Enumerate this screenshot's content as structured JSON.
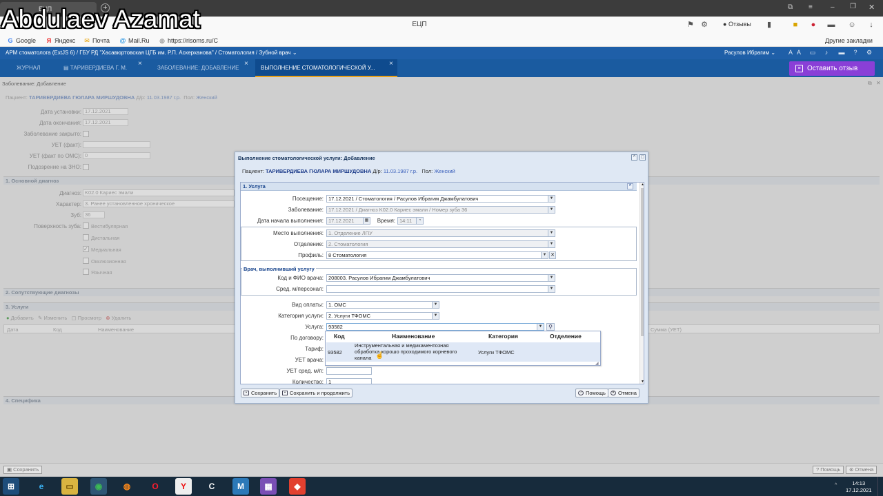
{
  "overlay": {
    "watermark": "Abdulaev Azamat"
  },
  "browser": {
    "tab_title": "ЕЦП",
    "site_title": "ЕЦП",
    "feedback_chip": "Отзывы",
    "bookmarks": [
      {
        "icon": "google-icon",
        "label": "Google"
      },
      {
        "icon": "yandex-icon",
        "label": "Яндекс"
      },
      {
        "icon": "mail-icon",
        "label": "Почта"
      },
      {
        "icon": "mailru-icon",
        "label": "Mail.Ru"
      },
      {
        "icon": "globe-icon",
        "label": "https://risoms.ru/C"
      }
    ],
    "other_bookmarks": "Другие закладки"
  },
  "app": {
    "title": "АРМ стоматолога (ExtJS 6) / ГБУ РД \"Хасавюртовская ЦГБ им. Р.П. Аскерханова\" / Стоматология / Зубной врач",
    "user": "Расулов Ибрагим",
    "tabs": [
      {
        "label": "ЖУРНАЛ"
      },
      {
        "label": "ТАРИВЕРДИЕВА Г. М."
      },
      {
        "label": "ЗАБОЛЕВАНИЕ: ДОБАВЛЕНИЕ"
      },
      {
        "label": "ВЫПОЛНЕНИЕ СТОМАТОЛОГИЧЕСКОЙ У..."
      }
    ],
    "feedback_button": "Оставить отзыв"
  },
  "background": {
    "title": "Заболевание: Добавление",
    "patient_label": "Пациент:",
    "patient_name": "ТАРИВЕРДИЕВА ГЮЛАРА МИРШУДОВНА",
    "dob_label": "Д/р:",
    "dob": "11.03.1987 г.р.",
    "sex_label": "Пол:",
    "sex": "Женский",
    "fields": [
      {
        "label": "Дата установки:",
        "value": "17.12.2021"
      },
      {
        "label": "Дата окончания:",
        "value": "17.12.2021"
      },
      {
        "label": "Заболевание закрыто:",
        "value": ""
      },
      {
        "label": "УЕТ (факт):",
        "value": ""
      },
      {
        "label": "УЕТ (факт по ОМС):",
        "value": "0"
      },
      {
        "label": "Подозрение на ЗНО:",
        "value": ""
      }
    ],
    "sect_main_diag": "1. Основной диагноз",
    "diag_label": "Диагноз:",
    "diag_value": "K02.0 Кариес эмали",
    "char_label": "Характер:",
    "char_value": "3. Ранее установленное хроническое",
    "tooth_label": "Зуб:",
    "tooth_value": "36",
    "surface_label": "Поверхность зуба:",
    "surfaces": [
      "Вестибулярная",
      "Дистальная",
      "Медиальная",
      "Окклюзионная",
      "Язычная"
    ],
    "sect_co_diag": "2. Сопутствующие диагнозы",
    "sect_services": "3. Услуги",
    "toolbar": [
      "Добавить",
      "Изменить",
      "Просмотр",
      "Удалить"
    ],
    "grid_cols": [
      "Дата",
      "Код",
      "Наименование",
      "Сумма (УЕТ)"
    ],
    "sect_spec": "4. Специфика",
    "save_label": "Сохранить",
    "help_label": "Помощь",
    "cancel_label": "Отмена"
  },
  "modal": {
    "title": "Выполнение стоматологической услуги: Добавление",
    "patient_label": "Пациент:",
    "patient_name": "ТАРИВЕРДИЕВА ГЮЛАРА МИРШУДОВНА",
    "dob_label": "Д/р:",
    "dob": "11.03.1987 г.р.",
    "sex_label": "Пол:",
    "sex": "Женский",
    "section": "1. Услуга",
    "visit_label": "Посещение:",
    "visit_value": "17.12.2021 / Стоматология / Расулов Ибрагим Джамбулатович",
    "disease_label": "Заболевание:",
    "disease_value": "17.12.2021 / Диагноз K02.0 Кариес эмали / Номер зуба 36",
    "start_label": "Дата начала выполнения:",
    "start_value": "17.12.2021",
    "time_label": "Время:",
    "time_value": "14:11",
    "place_label": "Место выполнения:",
    "place_value": "1. Отделение ЛПУ",
    "dept_label": "Отделение:",
    "dept_value": "2. Стоматология",
    "profile_label": "Профиль:",
    "profile_value": "8 Стоматология",
    "doctor_section": "Врач, выполнивший услугу",
    "doctor_label": "Код и ФИО врача:",
    "doctor_value": "208003. Расулов Ибрагим Джамбулатович",
    "staff_label": "Сред. м/персонал:",
    "staff_value": "",
    "pay_label": "Вид оплаты:",
    "pay_value": "1. ОМС",
    "cat_label": "Категория услуги:",
    "cat_value": "2. Услуги ТФОМС",
    "service_label": "Услуга:",
    "service_value": "93582",
    "contract_label": "По договору:",
    "tariff_label": "Тариф:",
    "uet_doc_label": "УЕТ врача:",
    "uet_staff_label": "УЕТ сред. м/п:",
    "qty_label": "Количество:",
    "qty_value": "1",
    "save": "Сохранить",
    "save_continue": "Сохранить и продолжить",
    "help": "Помощь",
    "cancel": "Отмена"
  },
  "dropdown": {
    "headers": [
      "Код",
      "Наименование",
      "Категория",
      "Отделение"
    ],
    "row": {
      "code": "93582",
      "name": [
        "Инструментальная и медикаментозная",
        "обработка хорошо проходимого корневого",
        "канала"
      ],
      "category": "Услуги ТФОМС",
      "dept": ""
    }
  },
  "taskbar": {
    "apps": [
      {
        "icon": "start-icon",
        "glyph": "⊞"
      },
      {
        "icon": "ie-icon",
        "glyph": "e"
      },
      {
        "icon": "explorer-icon",
        "glyph": "▭"
      },
      {
        "icon": "chrome-icon",
        "glyph": "◉"
      },
      {
        "icon": "firefox-icon",
        "glyph": "◍"
      },
      {
        "icon": "opera-icon",
        "glyph": "O"
      },
      {
        "icon": "yandex-browser-icon",
        "glyph": "Y"
      },
      {
        "icon": "ccleaner-icon",
        "glyph": "C"
      },
      {
        "icon": "mail-app-icon",
        "glyph": "M"
      },
      {
        "icon": "winrar-icon",
        "glyph": "▦"
      },
      {
        "icon": "anydesk-icon",
        "glyph": "◆"
      }
    ],
    "time": "14:13",
    "date": "17.12.2021"
  }
}
